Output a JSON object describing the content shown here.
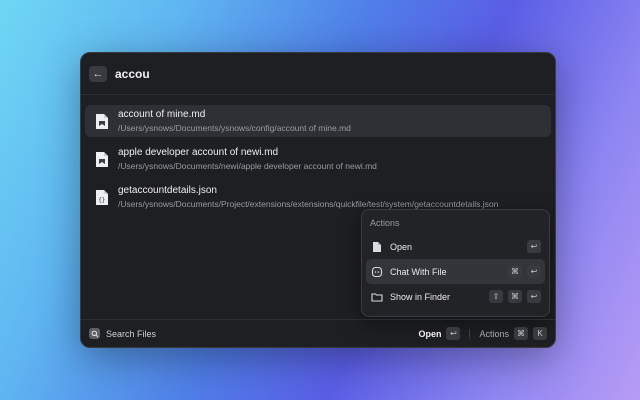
{
  "search": {
    "query": "accou"
  },
  "results": [
    {
      "title": "account of mine.md",
      "path": "/Users/ysnows/Documents/ysnows/config/account of mine.md",
      "icon": "markdown-file-icon"
    },
    {
      "title": "apple developer account of newi.md",
      "path": "/Users/ysnows/Documents/newi/apple developer account of newi.md",
      "icon": "markdown-file-icon"
    },
    {
      "title": "getaccountdetails.json",
      "path": "/Users/ysnows/Documents/Project/extensions/extensions/quickfile/test/system/getaccountdetails.json",
      "icon": "json-file-icon"
    }
  ],
  "actions": {
    "title": "Actions",
    "items": [
      {
        "label": "Open",
        "keys": [
          "↩"
        ],
        "icon": "document-icon"
      },
      {
        "label": "Chat With File",
        "keys": [
          "⌘",
          "↩"
        ],
        "icon": "chat-icon"
      },
      {
        "label": "Show in Finder",
        "keys": [
          "⇧",
          "⌘",
          "↩"
        ],
        "icon": "folder-icon"
      }
    ]
  },
  "footer": {
    "title": "Search Files",
    "primary_label": "Open",
    "primary_key": "↩",
    "secondary_label": "Actions",
    "secondary_keys": [
      "⌘",
      "K"
    ]
  },
  "colors": {
    "window_bg": "#1e1f23",
    "selected_row": "#2f3035",
    "text_primary": "#efeff1",
    "text_secondary": "#9a9ba1"
  }
}
